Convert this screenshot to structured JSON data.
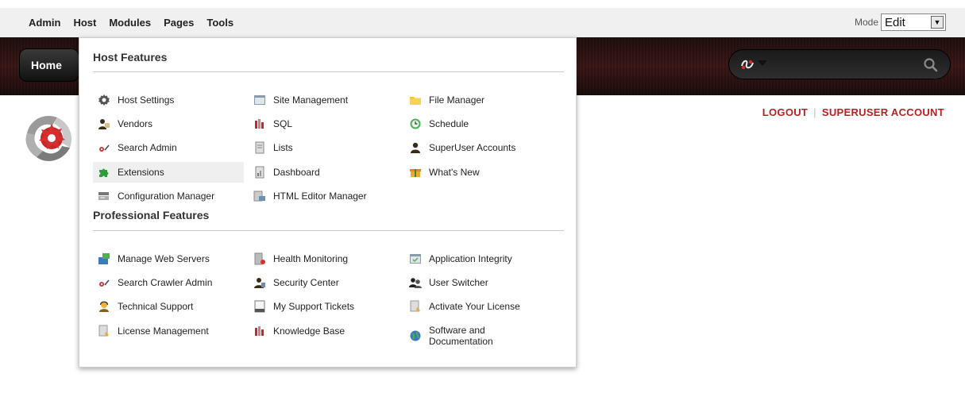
{
  "controlbar": {
    "menu": [
      "Admin",
      "Host",
      "Modules",
      "Pages",
      "Tools"
    ],
    "mode_label": "Mode",
    "mode_value": "Edit"
  },
  "banner": {
    "home_label": "Home"
  },
  "user": {
    "logout": "LOGOUT",
    "separator": "|",
    "account": "SUPERUSER ACCOUNT"
  },
  "host_menu": {
    "host_title": "Host Features",
    "host_items": [
      [
        "Host Settings",
        "Vendors",
        "Search Admin",
        "Extensions",
        "Configuration Manager"
      ],
      [
        "Site Management",
        "SQL",
        "Lists",
        "Dashboard",
        "HTML Editor Manager"
      ],
      [
        "File Manager",
        "Schedule",
        "SuperUser Accounts",
        "What's New"
      ]
    ],
    "pro_title": "Professional Features",
    "pro_items": [
      [
        "Manage Web Servers",
        "Search Crawler Admin",
        "Technical Support",
        "License Management"
      ],
      [
        "Health Monitoring",
        "Security Center",
        "My Support Tickets",
        "Knowledge Base"
      ],
      [
        "Application Integrity",
        "User Switcher",
        "Activate Your License",
        "Software and Documentation"
      ]
    ]
  },
  "colors": {
    "accent": "#b22222",
    "banner": "#2a1515"
  }
}
